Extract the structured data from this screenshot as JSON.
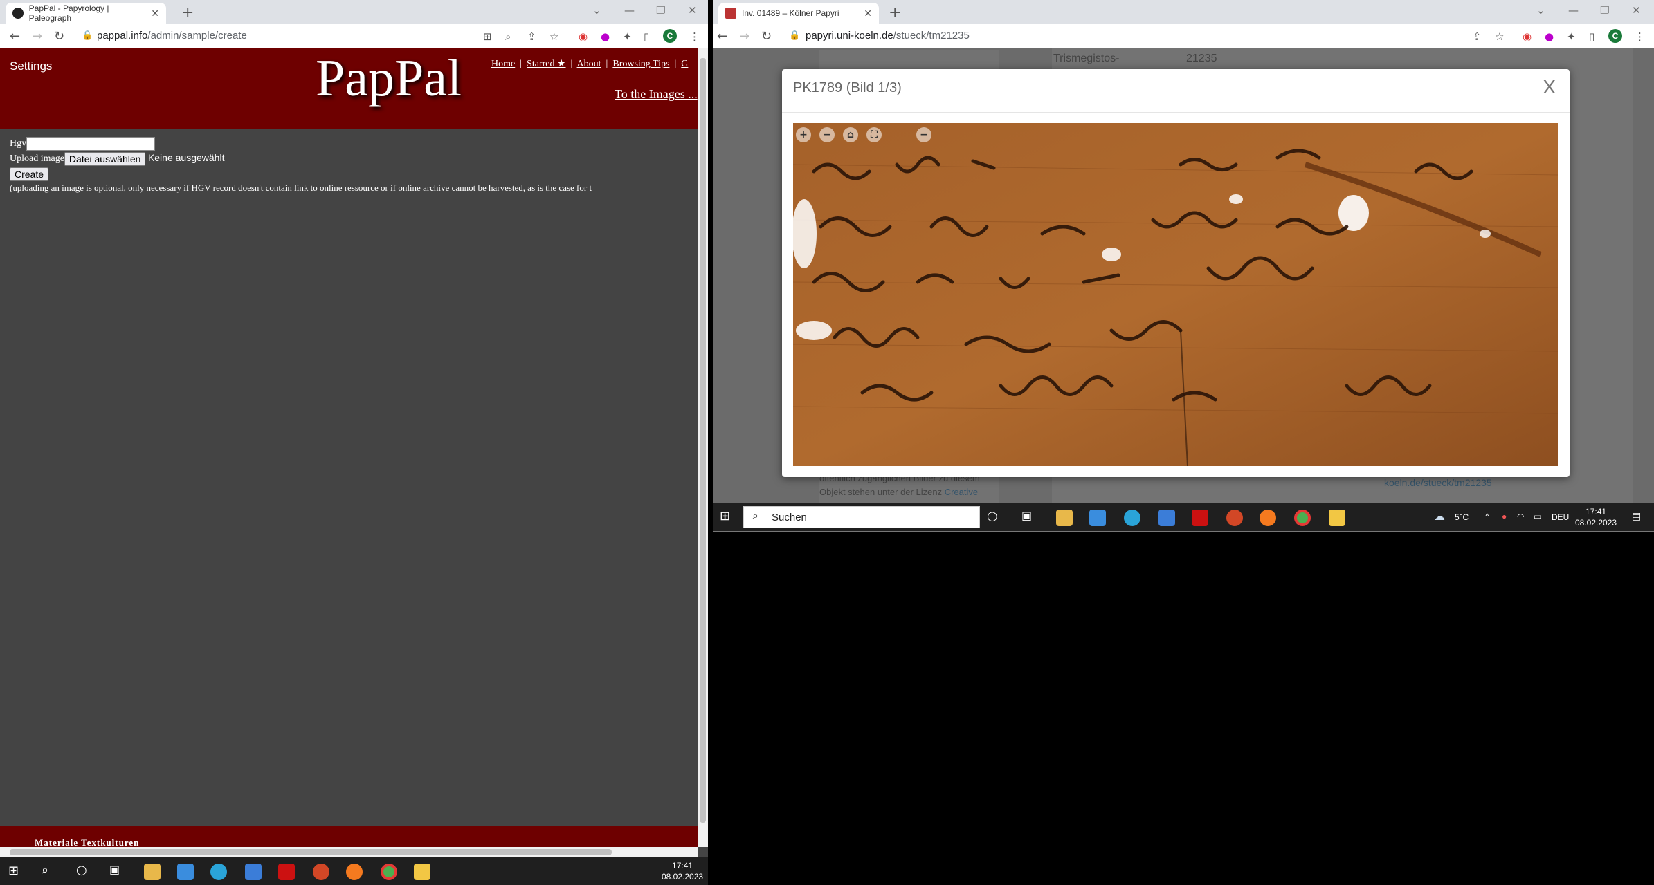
{
  "left_window": {
    "tab_title": "PapPal - Papyrology | Paleograph",
    "url_host": "pappal.info",
    "url_path": "/admin/sample/create",
    "avatar": "C",
    "header": {
      "settings": "Settings",
      "logo": "PapPal",
      "links": [
        "Home",
        "Starred ★",
        "About",
        "Browsing Tips",
        "G"
      ],
      "to_images": "To the Images ..."
    },
    "form": {
      "hgv_label": "Hgv",
      "upload_label": "Upload image",
      "file_button": "Datei auswählen",
      "no_file": "Keine ausgewählt",
      "create_button": "Create",
      "hint": "(uploading an image is optional, only necessary if HGV record doesn't contain link to online ressource or if online archive cannot be harvested, as is the case for t"
    },
    "footer": "Materiale Textkulturen",
    "taskbar_clock": {
      "time": "17:41",
      "date": "08.02.2023"
    }
  },
  "right_window": {
    "tab_title": "Inv. 01489 – Kölner Papyri",
    "url_host": "papyri.uni-koeln.de",
    "url_path": "/stueck/tm21235",
    "avatar": "C",
    "background": {
      "tm_label": "Trismegistos-",
      "tm_value": "21235",
      "text1": "öffentlich zugänglichen Bilder zu diesem",
      "text2": "Objekt stehen unter der Lizenz",
      "text2_link": "Creative",
      "link_right": "koeln.de/stueck/tm21235"
    },
    "modal": {
      "title": "PK1789 (Bild 1/3)",
      "close": "X"
    },
    "taskbar": {
      "search": "Suchen",
      "weather": "5°C",
      "lang": "DEU",
      "time": "17:41",
      "date": "08.02.2023"
    }
  },
  "colors": {
    "header_red": "#6e0000",
    "page_bg": "#444444",
    "papyrus": "#9a5a26"
  }
}
